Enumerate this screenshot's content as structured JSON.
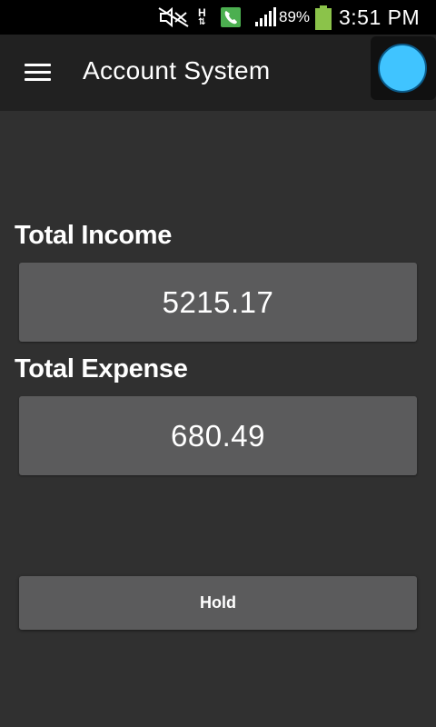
{
  "status_bar": {
    "icons": [
      "mute-icon",
      "data-h-icon",
      "phone-icon",
      "signal-icon",
      "battery-icon"
    ],
    "data_indicator": "H",
    "battery_percent": "89%",
    "battery_color": "#8BC34A",
    "time": "3:51 PM"
  },
  "toolbar": {
    "title": "Account System",
    "menu_icon": "hamburger-menu-icon",
    "fab_color": "#40C4FF"
  },
  "main": {
    "income_label": "Total Income",
    "income_value": "5215.17",
    "expense_label": "Total Expense",
    "expense_value": "680.49",
    "hold_button_label": "Hold"
  }
}
